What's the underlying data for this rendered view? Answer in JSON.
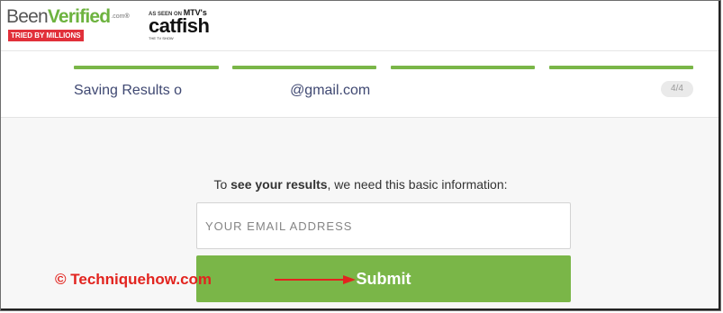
{
  "brand": {
    "name_part1": "Been",
    "name_part2": "Verified",
    "dotcom": ".com",
    "registered": "®",
    "tagline": "TRIED BY MILLIONS",
    "colors": {
      "gray": "#555555",
      "green": "#6db33f",
      "tag_red": "#e1303a"
    }
  },
  "as_seen": {
    "prefix": "AS SEEN ON",
    "network": "MTV's",
    "show": "catfish",
    "show_sub": "THE TV SHOW"
  },
  "progress": {
    "segments": 4,
    "completed": 4,
    "color": "#7ab648"
  },
  "saving": {
    "prefix": "Saving Results o",
    "suffix": "@gmail.com"
  },
  "step_badge": "4/4",
  "form": {
    "intro_before": "To ",
    "intro_bold": "see your results",
    "intro_after": ", we need this basic information:",
    "email_placeholder": "YOUR EMAIL ADDRESS",
    "submit_label": "Submit"
  },
  "watermark": "© Techniquehow.com",
  "annotation": {
    "arrow_icon": "right-arrow-icon",
    "color": "#e2241f"
  }
}
